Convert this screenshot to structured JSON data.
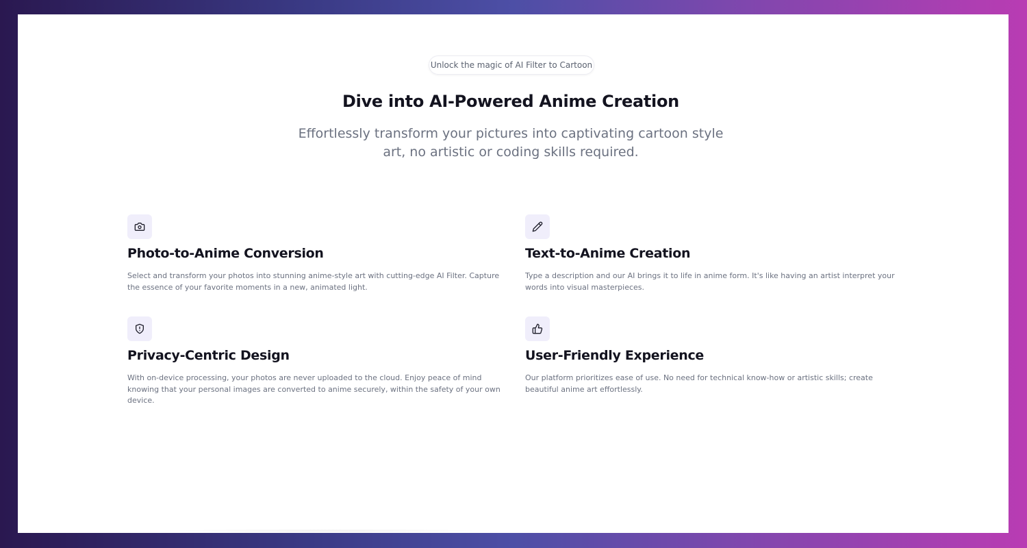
{
  "badge": "Unlock the magic of AI Filter to Cartoon",
  "title": "Dive into AI-Powered Anime Creation",
  "subtitle": "Effortlessly transform your pictures into captivating cartoon style art, no artistic or coding skills required.",
  "features": [
    {
      "icon": "camera-icon",
      "title": "Photo-to-Anime Conversion",
      "description": "Select and transform your photos into stunning anime-style art with cutting-edge AI Filter. Capture the essence of your favorite moments in a new, animated light."
    },
    {
      "icon": "pencil-icon",
      "title": "Text-to-Anime Creation",
      "description": "Type a description and our AI brings it to life in anime form. It's like having an artist interpret your words into visual masterpieces."
    },
    {
      "icon": "shield-icon",
      "title": "Privacy-Centric Design",
      "description": "With on-device processing, your photos are never uploaded to the cloud. Enjoy peace of mind knowing that your personal images are converted to anime securely, within the safety of your own device."
    },
    {
      "icon": "thumbs-up-icon",
      "title": "User-Friendly Experience",
      "description": "Our platform prioritizes ease of use. No need for technical know-how or artistic skills; create beautiful anime art effortlessly."
    }
  ],
  "colors": {
    "icon_background": "#f0eefb",
    "heading": "#13131f",
    "body_text": "#6b7180",
    "gradient_start": "#2a1850",
    "gradient_end": "#b93cb3"
  }
}
